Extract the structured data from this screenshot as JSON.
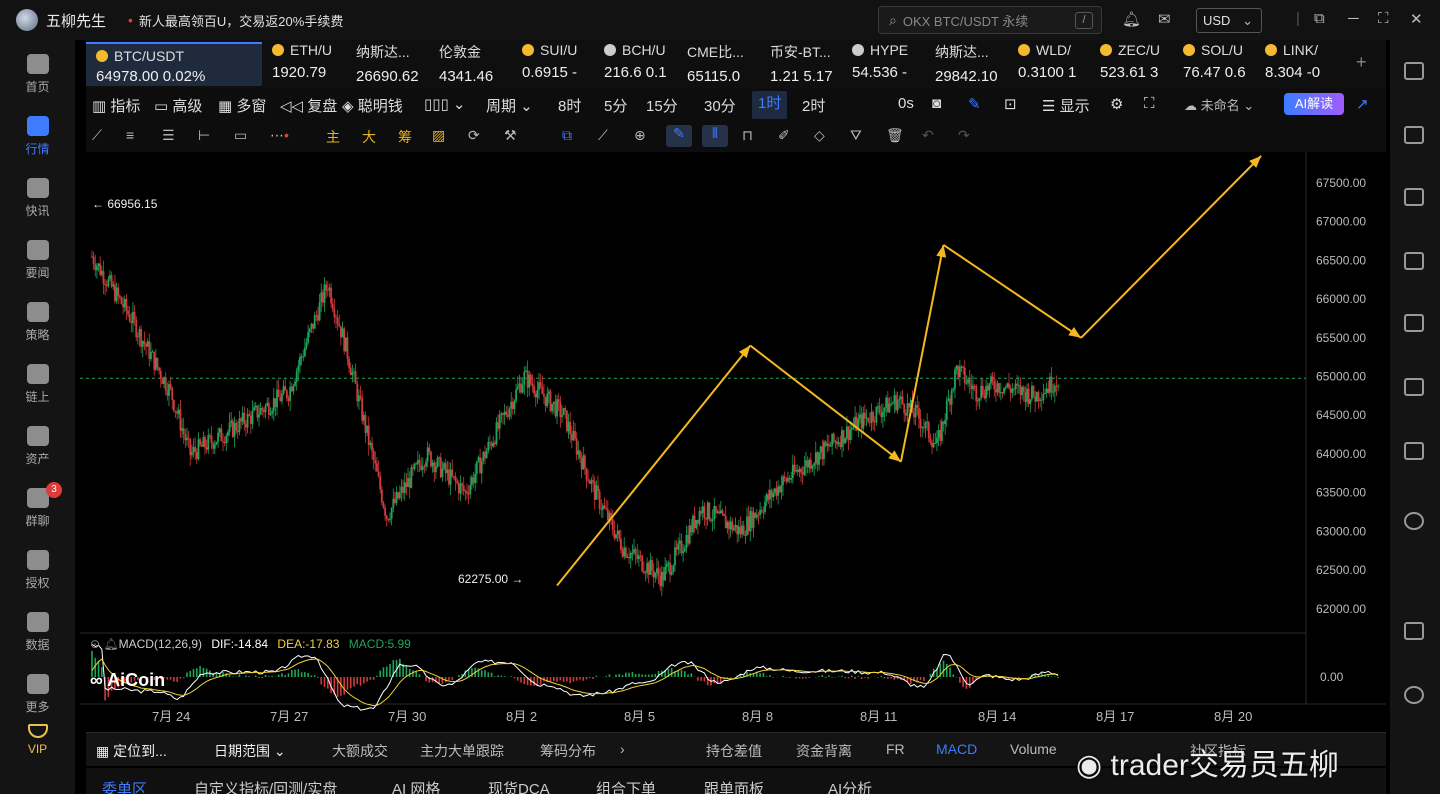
{
  "app": {
    "title": "五柳先生",
    "announcement": "新人最高领百U，交易返20%手续费",
    "search_placeholder": "OKX BTC/USDT 永续",
    "search_shortcut": "/",
    "currency": "USD"
  },
  "left_nav": [
    {
      "label": "首页",
      "icon": "home-icon"
    },
    {
      "label": "行情",
      "icon": "market-icon",
      "active": true
    },
    {
      "label": "快讯",
      "icon": "news-flash-icon"
    },
    {
      "label": "要闻",
      "icon": "headline-icon"
    },
    {
      "label": "策略",
      "icon": "strategy-icon"
    },
    {
      "label": "链上",
      "icon": "onchain-icon"
    },
    {
      "label": "资产",
      "icon": "wallet-icon"
    },
    {
      "label": "群聊",
      "icon": "chat-icon",
      "badge": "3"
    },
    {
      "label": "授权",
      "icon": "key-icon"
    },
    {
      "label": "数据",
      "icon": "data-icon"
    },
    {
      "label": "更多",
      "icon": "more-icon"
    },
    {
      "label": "VIP",
      "icon": "vip-icon"
    }
  ],
  "tickers": [
    {
      "name": "BTC/USDT",
      "price": "64978.00",
      "change": "0.02%"
    },
    {
      "name": "ETH/U",
      "price": "1920.79"
    },
    {
      "name": "纳斯达...",
      "price": "26690.62"
    },
    {
      "name": "伦敦金",
      "price": "4341.46"
    },
    {
      "name": "SUI/U",
      "price": "0.6915 -"
    },
    {
      "name": "BCH/U",
      "price": "216.6 0.1"
    },
    {
      "name": "CME比...",
      "price": "65115.0"
    },
    {
      "name": "币安-BT...",
      "price": "1.21 5.17"
    },
    {
      "name": "HYPE",
      "price": "54.536 -"
    },
    {
      "name": "纳斯达...",
      "price": "29842.10"
    },
    {
      "name": "WLD/",
      "price": "0.3100 1"
    },
    {
      "name": "ZEC/U",
      "price": "523.61 3"
    },
    {
      "name": "SOL/U",
      "price": "76.47 0.6"
    },
    {
      "name": "LINK/",
      "price": "8.304 -0"
    }
  ],
  "toolbar": {
    "items": [
      "指标",
      "高级",
      "多窗",
      "复盘",
      "聪明钱",
      "周期"
    ],
    "periods": [
      "8时",
      "5分",
      "15分",
      "30分",
      "1时",
      "2时"
    ],
    "active_period": "1时",
    "countdown": "0s",
    "display": "显示",
    "layout_name": "未命名",
    "ai_button": "AI解读"
  },
  "drawing_tools": {
    "labels": [
      "主",
      "大",
      "筹"
    ]
  },
  "chart_data": {
    "type": "candlestick",
    "symbol": "BTC/USDT",
    "interval": "1时",
    "price_axis": [
      "67500.00",
      "67000.00",
      "66500.00",
      "66000.00",
      "65500.00",
      "65000.00",
      "64500.00",
      "64000.00",
      "63500.00",
      "63000.00",
      "62500.00",
      "62000.00"
    ],
    "ylim": [
      61700,
      67900
    ],
    "date_axis": [
      "7月 24",
      "7月 27",
      "7月 30",
      "8月 2",
      "8月 5",
      "8月 8",
      "8月 11",
      "8月 14",
      "8月 17",
      "8月 20"
    ],
    "last_price": 64978.0,
    "high_marker": "← 66956.15",
    "low_marker": "62275.00 →",
    "close_path_days": [
      [
        0,
        66550
      ],
      [
        1.0,
        65750
      ],
      [
        2.0,
        64800
      ],
      [
        2.5,
        64000
      ],
      [
        3.5,
        64300
      ],
      [
        5.0,
        64800
      ],
      [
        6.0,
        66200
      ],
      [
        6.5,
        65300
      ],
      [
        7.5,
        63200
      ],
      [
        8.5,
        64000
      ],
      [
        9.5,
        63500
      ],
      [
        10.5,
        64500
      ],
      [
        11.0,
        65000
      ],
      [
        12.0,
        64500
      ],
      [
        12.8,
        63500
      ],
      [
        13.5,
        62800
      ],
      [
        14.5,
        62400
      ],
      [
        15.0,
        62800
      ],
      [
        15.5,
        63300
      ],
      [
        16.5,
        63000
      ],
      [
        17.5,
        63600
      ],
      [
        18.5,
        64000
      ],
      [
        19.5,
        64400
      ],
      [
        20.5,
        64700
      ],
      [
        21.0,
        64500
      ],
      [
        21.5,
        64100
      ],
      [
        22.0,
        65100
      ],
      [
        22.5,
        64800
      ],
      [
        23.0,
        64900
      ],
      [
        24.0,
        64750
      ],
      [
        24.6,
        64978
      ]
    ],
    "projection_path": [
      [
        "8月 3 08:00",
        62300
      ],
      [
        "8月 8 06:00",
        65400
      ],
      [
        "8月 12 02:00",
        63900
      ],
      [
        "8月 13 04:00",
        66700
      ],
      [
        "8月 16 16:00",
        65500
      ],
      [
        "8月 21 06:00",
        67850
      ]
    ],
    "macd": {
      "label": "MACD(12,26,9)",
      "dif": "DIF:-14.84",
      "dea": "DEA:-17.83",
      "macd": "MACD:5.99",
      "axis": "0.00"
    },
    "colors": {
      "up": "#1fa55a",
      "down": "#d23b3b",
      "projection": "#f5b81e",
      "dif": "#ffffff",
      "dea": "#f1d43a"
    }
  },
  "bottom_tabs": [
    "定位到...",
    "日期范围",
    "大额成交",
    "主力大单跟踪",
    "筹码分布",
    "持仓差值",
    "资金背离",
    "FR",
    "MACD",
    "Volume",
    "社区指标"
  ],
  "bottom_tabs_active": "MACD",
  "panel_tabs": [
    "委单区",
    "自定义指标/回测/实盘",
    "AI 网格",
    "现货DCA",
    "组合下单",
    "跟单面板",
    "AI分析"
  ],
  "panel_tabs_active": "委单区",
  "watermark": "trader交易员五柳",
  "brand_logo": "AiCoin"
}
